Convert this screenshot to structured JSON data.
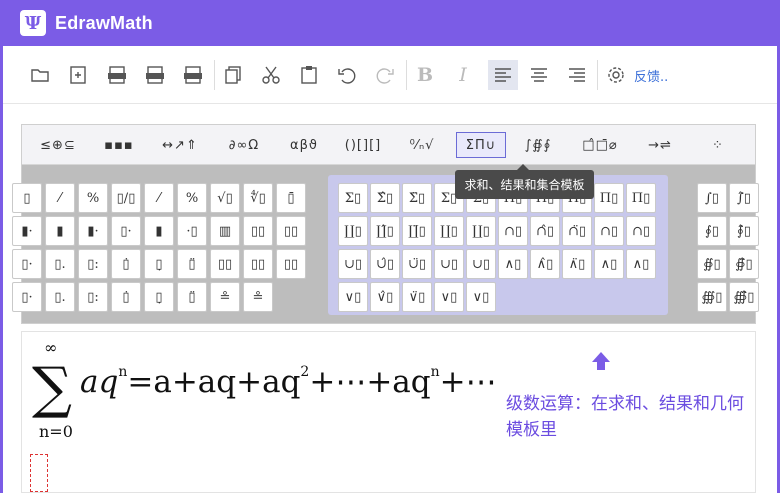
{
  "app": {
    "title": "EdrawMath",
    "logo_glyph": "Ψ"
  },
  "toolbar": {
    "buttons": [
      {
        "name": "open-icon"
      },
      {
        "name": "new-icon"
      },
      {
        "name": "export-jpg-icon"
      },
      {
        "name": "export-png-icon"
      },
      {
        "name": "export-svg-icon"
      },
      {
        "name": "copy-icon"
      },
      {
        "name": "cut-icon"
      },
      {
        "name": "paste-icon"
      },
      {
        "name": "undo-icon"
      },
      {
        "name": "redo-icon"
      },
      {
        "name": "bold-icon"
      },
      {
        "name": "italic-icon"
      },
      {
        "name": "align-left-icon"
      },
      {
        "name": "align-center-icon"
      },
      {
        "name": "align-right-icon"
      },
      {
        "name": "settings-icon"
      }
    ],
    "bold_label": "B",
    "italic_label": "I",
    "feedback_label": "反馈.."
  },
  "palette": {
    "categories": [
      "≤⊕⊆",
      "▪▪▪",
      "↔↗⇑",
      "∂∞Ω",
      "αβϑ",
      "()[][]",
      "⁰⁄ₙ√",
      "ΣΠ∪",
      "∫∯∮",
      "□̂□̄⌀",
      "→⇌",
      "⁘"
    ],
    "selected_category": "ΣΠ∪",
    "tooltip": "求和、结果和集合模板",
    "left_group": [
      [
        "▯",
        "⁄",
        "%",
        "▯/▯",
        "⁄",
        "%",
        "√▯",
        "∜▯",
        "▯̄"
      ],
      [
        "▮·",
        "▮",
        "▮·",
        "▯·",
        "▮",
        "·▯",
        "▥",
        "▯▯",
        "▯▯"
      ],
      [
        "▯·",
        "▯.",
        "▯:",
        "▯̇",
        "▯̣",
        "▯̈",
        "▯▯",
        "▯▯",
        "▯▯"
      ],
      [
        "▯·",
        "▯.",
        "▯:",
        "▯̇",
        "▯̣",
        "▯̈",
        "≗",
        "≗"
      ]
    ],
    "middle_group": [
      [
        "Σ▯",
        "Σ̂▯",
        "Σ̈▯",
        "Σ▯",
        "Σ▯",
        "Π▯",
        "Π̂▯",
        "Π̈▯",
        "Π▯",
        "Π▯"
      ],
      [
        "∐▯",
        "∐̂▯",
        "∐̈▯",
        "∐▯",
        "∐▯",
        "∩▯",
        "∩̂▯",
        "∩̈▯",
        "∩▯",
        "∩▯"
      ],
      [
        "∪▯",
        "∪̂▯",
        "∪̈▯",
        "∪▯",
        "∪▯",
        "∧▯",
        "∧̂▯",
        "∧̈▯",
        "∧▯",
        "∧▯"
      ],
      [
        "∨▯",
        "∨̂▯",
        "∨̈▯",
        "∨▯",
        "∨▯"
      ]
    ],
    "right_group": [
      [
        "∫▯",
        "∫̂▯"
      ],
      [
        "∮▯",
        "∮̂▯"
      ],
      [
        "∯▯",
        "∯̂▯"
      ],
      [
        "∰▯",
        "∰̂▯"
      ]
    ]
  },
  "editor": {
    "sum_symbol": "∑",
    "upper_limit": "∞",
    "lower_limit": "n=0",
    "expression_parts": [
      "aq",
      "n",
      "=a+aq+aq",
      "2",
      "+⋯+aq",
      "n",
      "+⋯"
    ],
    "annotation": "级数运算：在求和、结果和几何模板里"
  },
  "colors": {
    "brand": "#7b5ce6",
    "annotation": "#6b4ce0",
    "palette_highlight": "#c8c8ec"
  }
}
